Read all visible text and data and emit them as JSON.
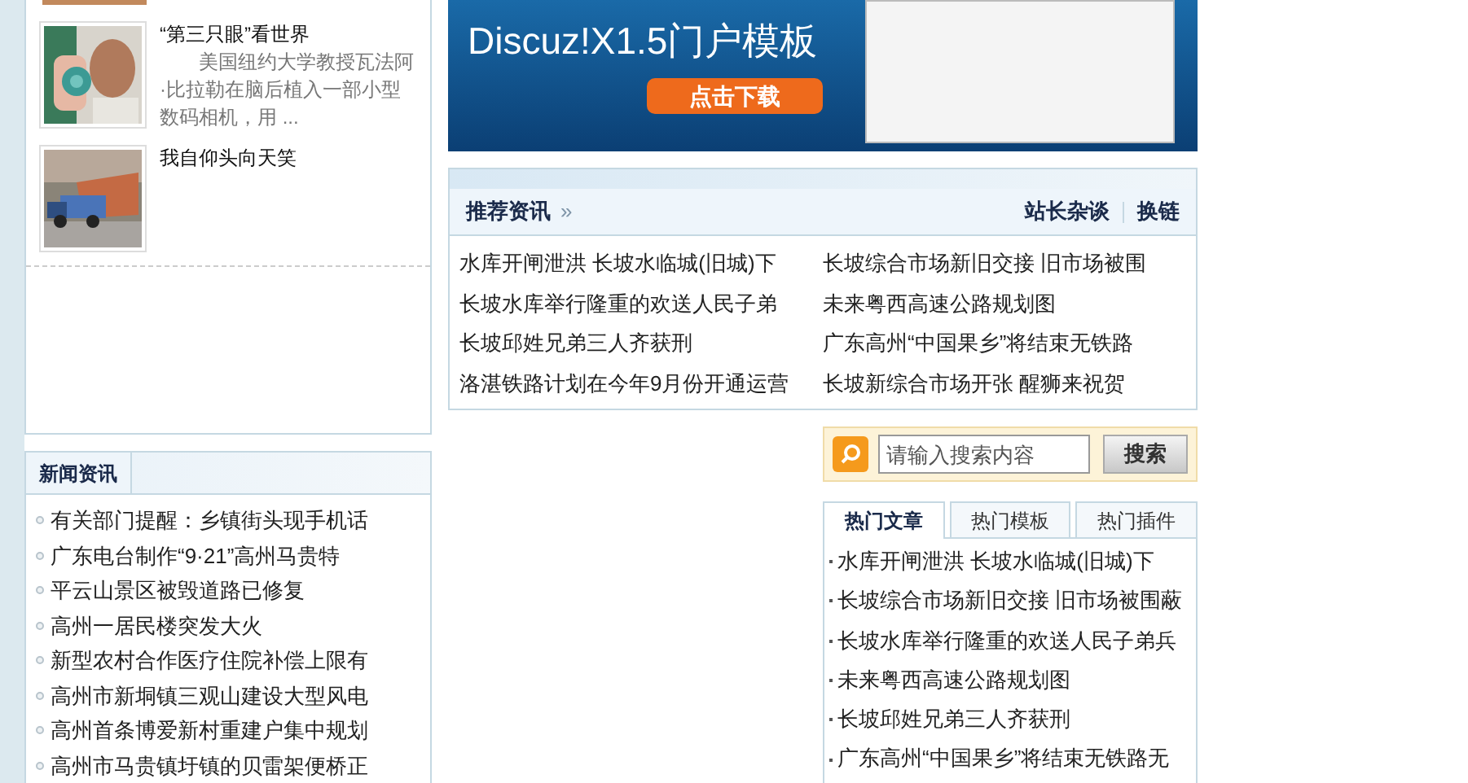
{
  "photo_news": [
    {
      "title": "“第三只眼”看世界",
      "summary": "美国纽约大学教授瓦法阿·比拉勒在脑后植入一部小型数码相机，用 ..."
    },
    {
      "title": "我自仰头向天笑"
    }
  ],
  "news": {
    "title": "新闻资讯",
    "items": [
      "有关部门提醒：乡镇街头现手机话",
      "广东电台制作“9·21”高州马贵特",
      "平云山景区被毁道路已修复",
      "高州一居民楼突发大火",
      "新型农村合作医疗住院补偿上限有",
      "高州市新垌镇三观山建设大型风电",
      "高州首条博爱新村重建户集中规划",
      "高州市马贵镇圩镇的贝雷架便桥正"
    ]
  },
  "banner": {
    "title": "Discuz!X1.5门户模板",
    "button": "点击下载"
  },
  "recommend": {
    "title": "推荐资讯",
    "more": "»",
    "links": [
      "站长杂谈",
      "换链"
    ],
    "items": [
      "水库开闸泄洪 长坡水临城(旧城)下",
      "长坡综合市场新旧交接 旧市场被围",
      "长坡水库举行隆重的欢送人民子弟",
      "未来粤西高速公路规划图",
      "长坡邱姓兄弟三人齐获刑",
      "广东高州“中国果乡”将结束无铁路",
      "洛湛铁路计划在今年9月份开通运营",
      "长坡新综合市场开张 醒狮来祝贺"
    ]
  },
  "search": {
    "placeholder": "请输入搜索内容",
    "button": "搜索"
  },
  "hot": {
    "tabs": [
      {
        "label": "热门文章",
        "selected": true
      },
      {
        "label": "热门模板",
        "selected": false
      },
      {
        "label": "热门插件",
        "selected": false
      }
    ],
    "items": [
      "水库开闸泄洪 长坡水临城(旧城)下",
      "长坡综合市场新旧交接 旧市场被围蔽",
      "长坡水库举行隆重的欢送人民子弟兵",
      "未来粤西高速公路规划图",
      "长坡邱姓兄弟三人齐获刑",
      "广东高州“中国果乡”将结束无铁路无"
    ]
  }
}
